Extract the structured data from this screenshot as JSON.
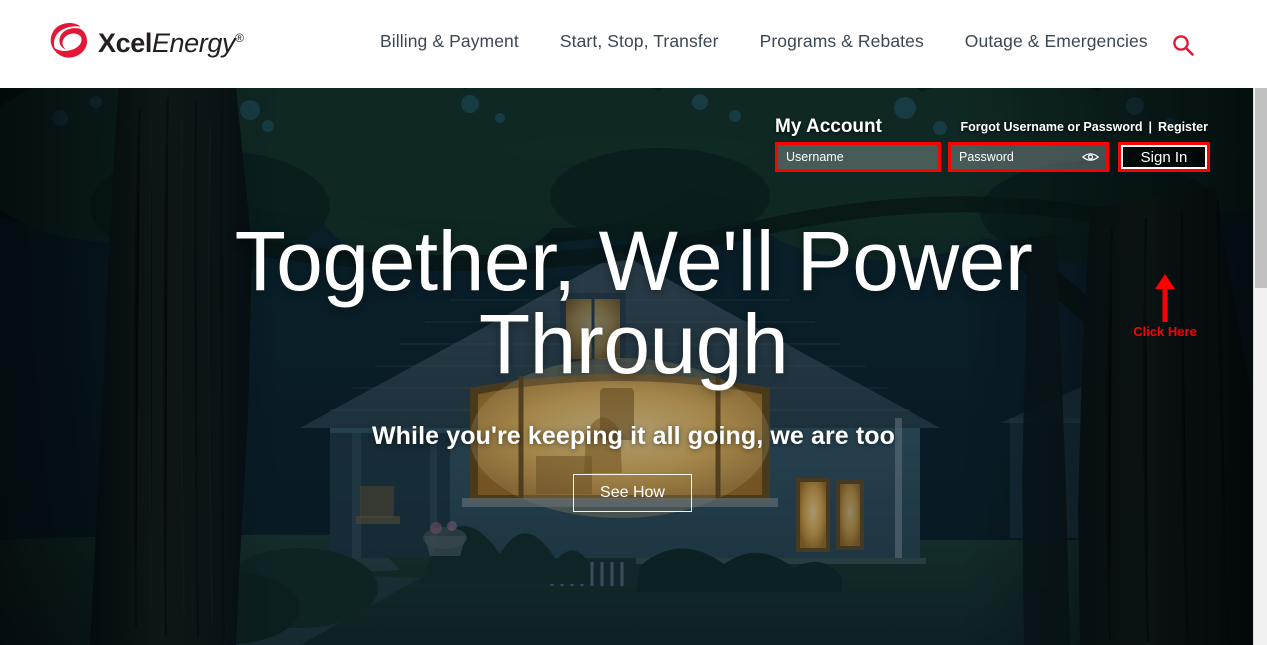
{
  "brand": {
    "logo_name_bold": "Xcel",
    "logo_name_italic": "Energy",
    "logo_registered": "®",
    "logo_color": "#e31837",
    "accent_color": "#e31837"
  },
  "nav": {
    "items": [
      {
        "label": "Billing & Payment"
      },
      {
        "label": "Start, Stop, Transfer"
      },
      {
        "label": "Programs & Rebates"
      },
      {
        "label": "Outage & Emergencies"
      }
    ],
    "search_icon": "search-icon"
  },
  "account": {
    "title": "My Account",
    "forgot_link": "Forgot Username or Password",
    "separator": "|",
    "register_link": "Register",
    "username_placeholder": "Username",
    "username_value": "",
    "password_placeholder": "Password",
    "password_value": "",
    "show_password_icon": "eye-icon",
    "signin_label": "Sign In"
  },
  "annotation": {
    "click_label": "Click Here",
    "color": "#fe0000",
    "arrow_icon": "arrow-up-icon"
  },
  "hero": {
    "heading_line1": "Together, We'll Power",
    "heading_line2": "Through",
    "subheading": "While you're keeping it all going, we are too",
    "cta_label": "See How",
    "background_description": "Night photo of a suburban house with warm lit windows framed by dark trees"
  },
  "scrollbar": {
    "orientation": "vertical",
    "thumb_position_percent": 0
  }
}
